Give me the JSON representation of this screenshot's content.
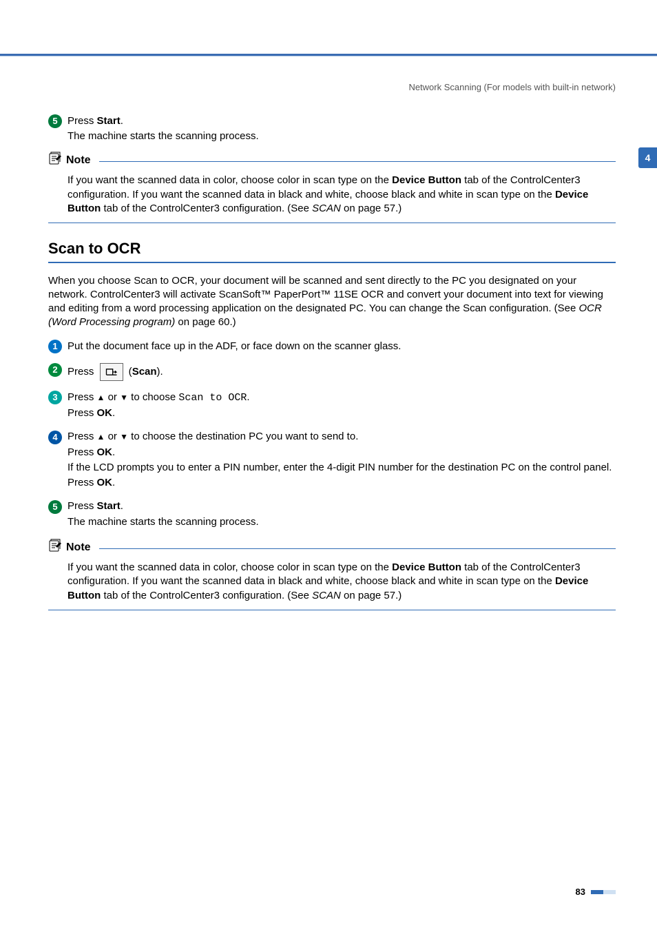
{
  "breadcrumb": "Network Scanning (For models with built-in network)",
  "side_tab": "4",
  "page_number": "83",
  "top_step": {
    "num": "5",
    "line1_a": "Press ",
    "line1_b": "Start",
    "line1_c": ".",
    "line2": "The machine starts the scanning process."
  },
  "note_label": "Note",
  "note1": {
    "t1": "If you want the scanned data in color, choose color in scan type on the ",
    "t2": "Device Button",
    "t3": " tab of the ControlCenter3 configuration. If you want the scanned data in black and white, choose black and white in scan type on the ",
    "t4": "Device Button",
    "t5": " tab of the ControlCenter3 configuration. (See ",
    "t6": "SCAN",
    "t7": " on page 57.)"
  },
  "h2": "Scan to OCR",
  "intro": {
    "t1": "When you choose Scan to OCR, your document will be scanned and sent directly to the PC you designated on your network. ControlCenter3 will activate ScanSoft™ PaperPort™ 11SE OCR and convert your document into text for viewing and editing from a word processing application on the designated PC. You can change the Scan configuration. (See ",
    "t2": "OCR (Word Processing program)",
    "t3": " on page 60.)"
  },
  "steps": {
    "s1": {
      "num": "1",
      "text": "Put the document face up in the ADF, or face down on the scanner glass."
    },
    "s2": {
      "num": "2",
      "pre": "Press ",
      "post1": " (",
      "post2": "Scan",
      "post3": ")."
    },
    "s3": {
      "num": "3",
      "l1a": "Press ",
      "l1b": " or ",
      "l1c": " to choose ",
      "code": "Scan to OCR",
      "l1d": ".",
      "l2a": "Press ",
      "l2b": "OK",
      "l2c": "."
    },
    "s4": {
      "num": "4",
      "l1a": "Press ",
      "l1b": " or ",
      "l1c": " to choose the destination PC you want to send to.",
      "l2a": "Press ",
      "l2b": "OK",
      "l2c": ".",
      "l3": "If the LCD prompts you to enter a PIN number, enter the 4-digit PIN number for the destination PC on the control panel.",
      "l4a": "Press ",
      "l4b": "OK",
      "l4c": "."
    },
    "s5": {
      "num": "5",
      "l1a": "Press ",
      "l1b": "Start",
      "l1c": ".",
      "l2": "The machine starts the scanning process."
    }
  },
  "note2": {
    "t1": "If you want the scanned data in color, choose color in scan type on the ",
    "t2": "Device Button",
    "t3": " tab of the ControlCenter3 configuration. If you want the scanned data in black and white, choose black and white in scan type on the ",
    "t4": "Device Button",
    "t5": " tab of the ControlCenter3 configuration. (See ",
    "t6": "SCAN",
    "t7": " on page 57.)"
  }
}
